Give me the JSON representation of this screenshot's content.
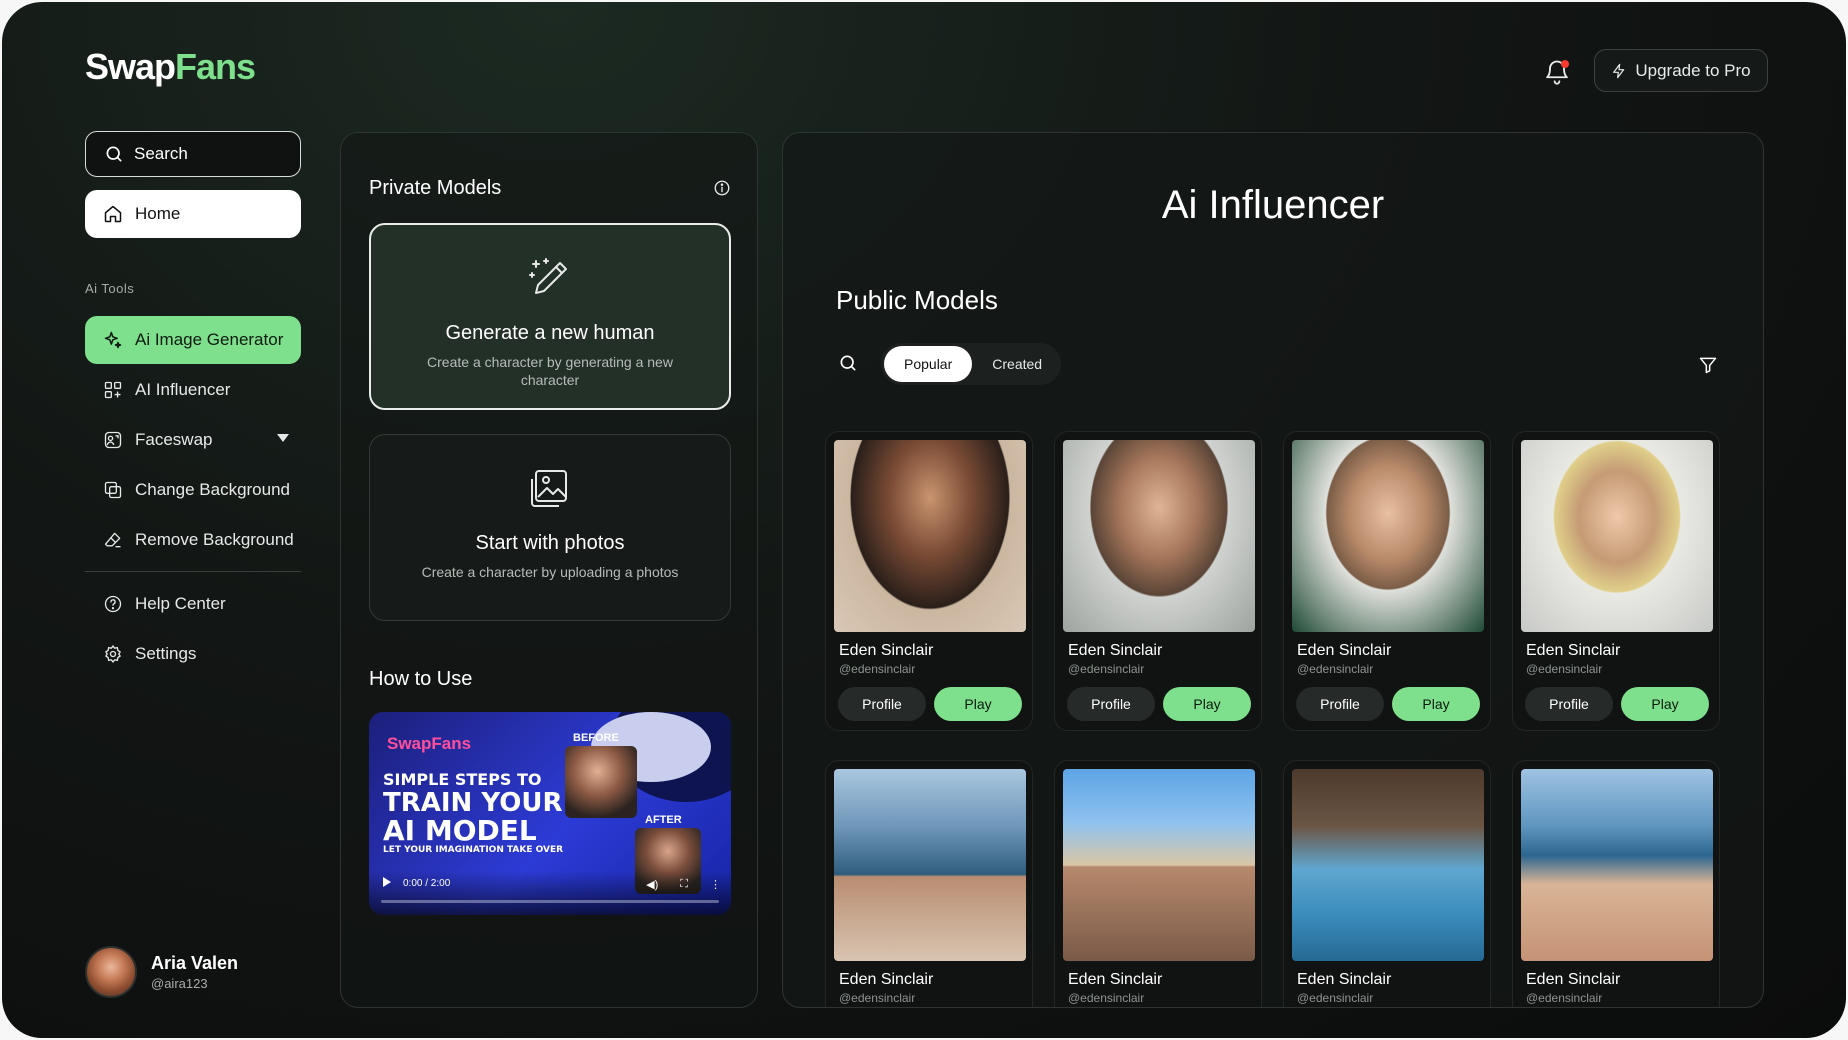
{
  "brand": {
    "part1": "Swap",
    "part2": "Fans"
  },
  "header": {
    "upgrade_label": "Upgrade to Pro"
  },
  "sidebar": {
    "search_placeholder": "Search",
    "home_label": "Home",
    "section_label": "Ai Tools",
    "tools": [
      {
        "label": "Ai Image Generator",
        "icon": "sparkle-icon",
        "active": true
      },
      {
        "label": "AI Influencer",
        "icon": "grid-plus-icon"
      },
      {
        "label": "Faceswap",
        "icon": "faceswap-icon",
        "has_dropdown": true
      },
      {
        "label": "Change Background",
        "icon": "layers-icon"
      },
      {
        "label": "Remove Background",
        "icon": "eraser-icon"
      }
    ],
    "bottom": [
      {
        "label": "Help Center",
        "icon": "help-icon"
      },
      {
        "label": "Settings",
        "icon": "gear-icon"
      }
    ],
    "user": {
      "name": "Aria Valen",
      "handle": "@aira123"
    }
  },
  "private_models": {
    "title": "Private Models",
    "generate": {
      "title": "Generate a new human",
      "subtitle": "Create a character by generating a new character"
    },
    "photos": {
      "title": "Start with photos",
      "subtitle": "Create a character by uploading a photos"
    },
    "how_to_title": "How to Use",
    "video": {
      "brand": "SwapFans",
      "line1": "SIMPLE STEPS TO",
      "line2": "TRAIN YOUR",
      "line3": "AI MODEL",
      "line4": "LET YOUR IMAGINATION TAKE OVER",
      "before": "BEFORE",
      "after": "AFTER",
      "time": "0:00 / 2:00"
    }
  },
  "main": {
    "title": "Ai Influencer",
    "subtitle": "Public Models",
    "tabs": [
      {
        "label": "Popular",
        "active": true
      },
      {
        "label": "Created",
        "active": false
      }
    ],
    "profile_label": "Profile",
    "play_label": "Play",
    "models": [
      {
        "name": "Eden Sinclair",
        "handle": "@edensinclair"
      },
      {
        "name": "Eden Sinclair",
        "handle": "@edensinclair"
      },
      {
        "name": "Eden Sinclair",
        "handle": "@edensinclair"
      },
      {
        "name": "Eden Sinclair",
        "handle": "@edensinclair"
      },
      {
        "name": "Eden Sinclair",
        "handle": "@edensinclair"
      },
      {
        "name": "Eden Sinclair",
        "handle": "@edensinclair"
      },
      {
        "name": "Eden Sinclair",
        "handle": "@edensinclair"
      },
      {
        "name": "Eden Sinclair",
        "handle": "@edensinclair"
      }
    ]
  },
  "colors": {
    "accent": "#7ee08d",
    "background": "#121614",
    "notification": "#ff3b30"
  }
}
